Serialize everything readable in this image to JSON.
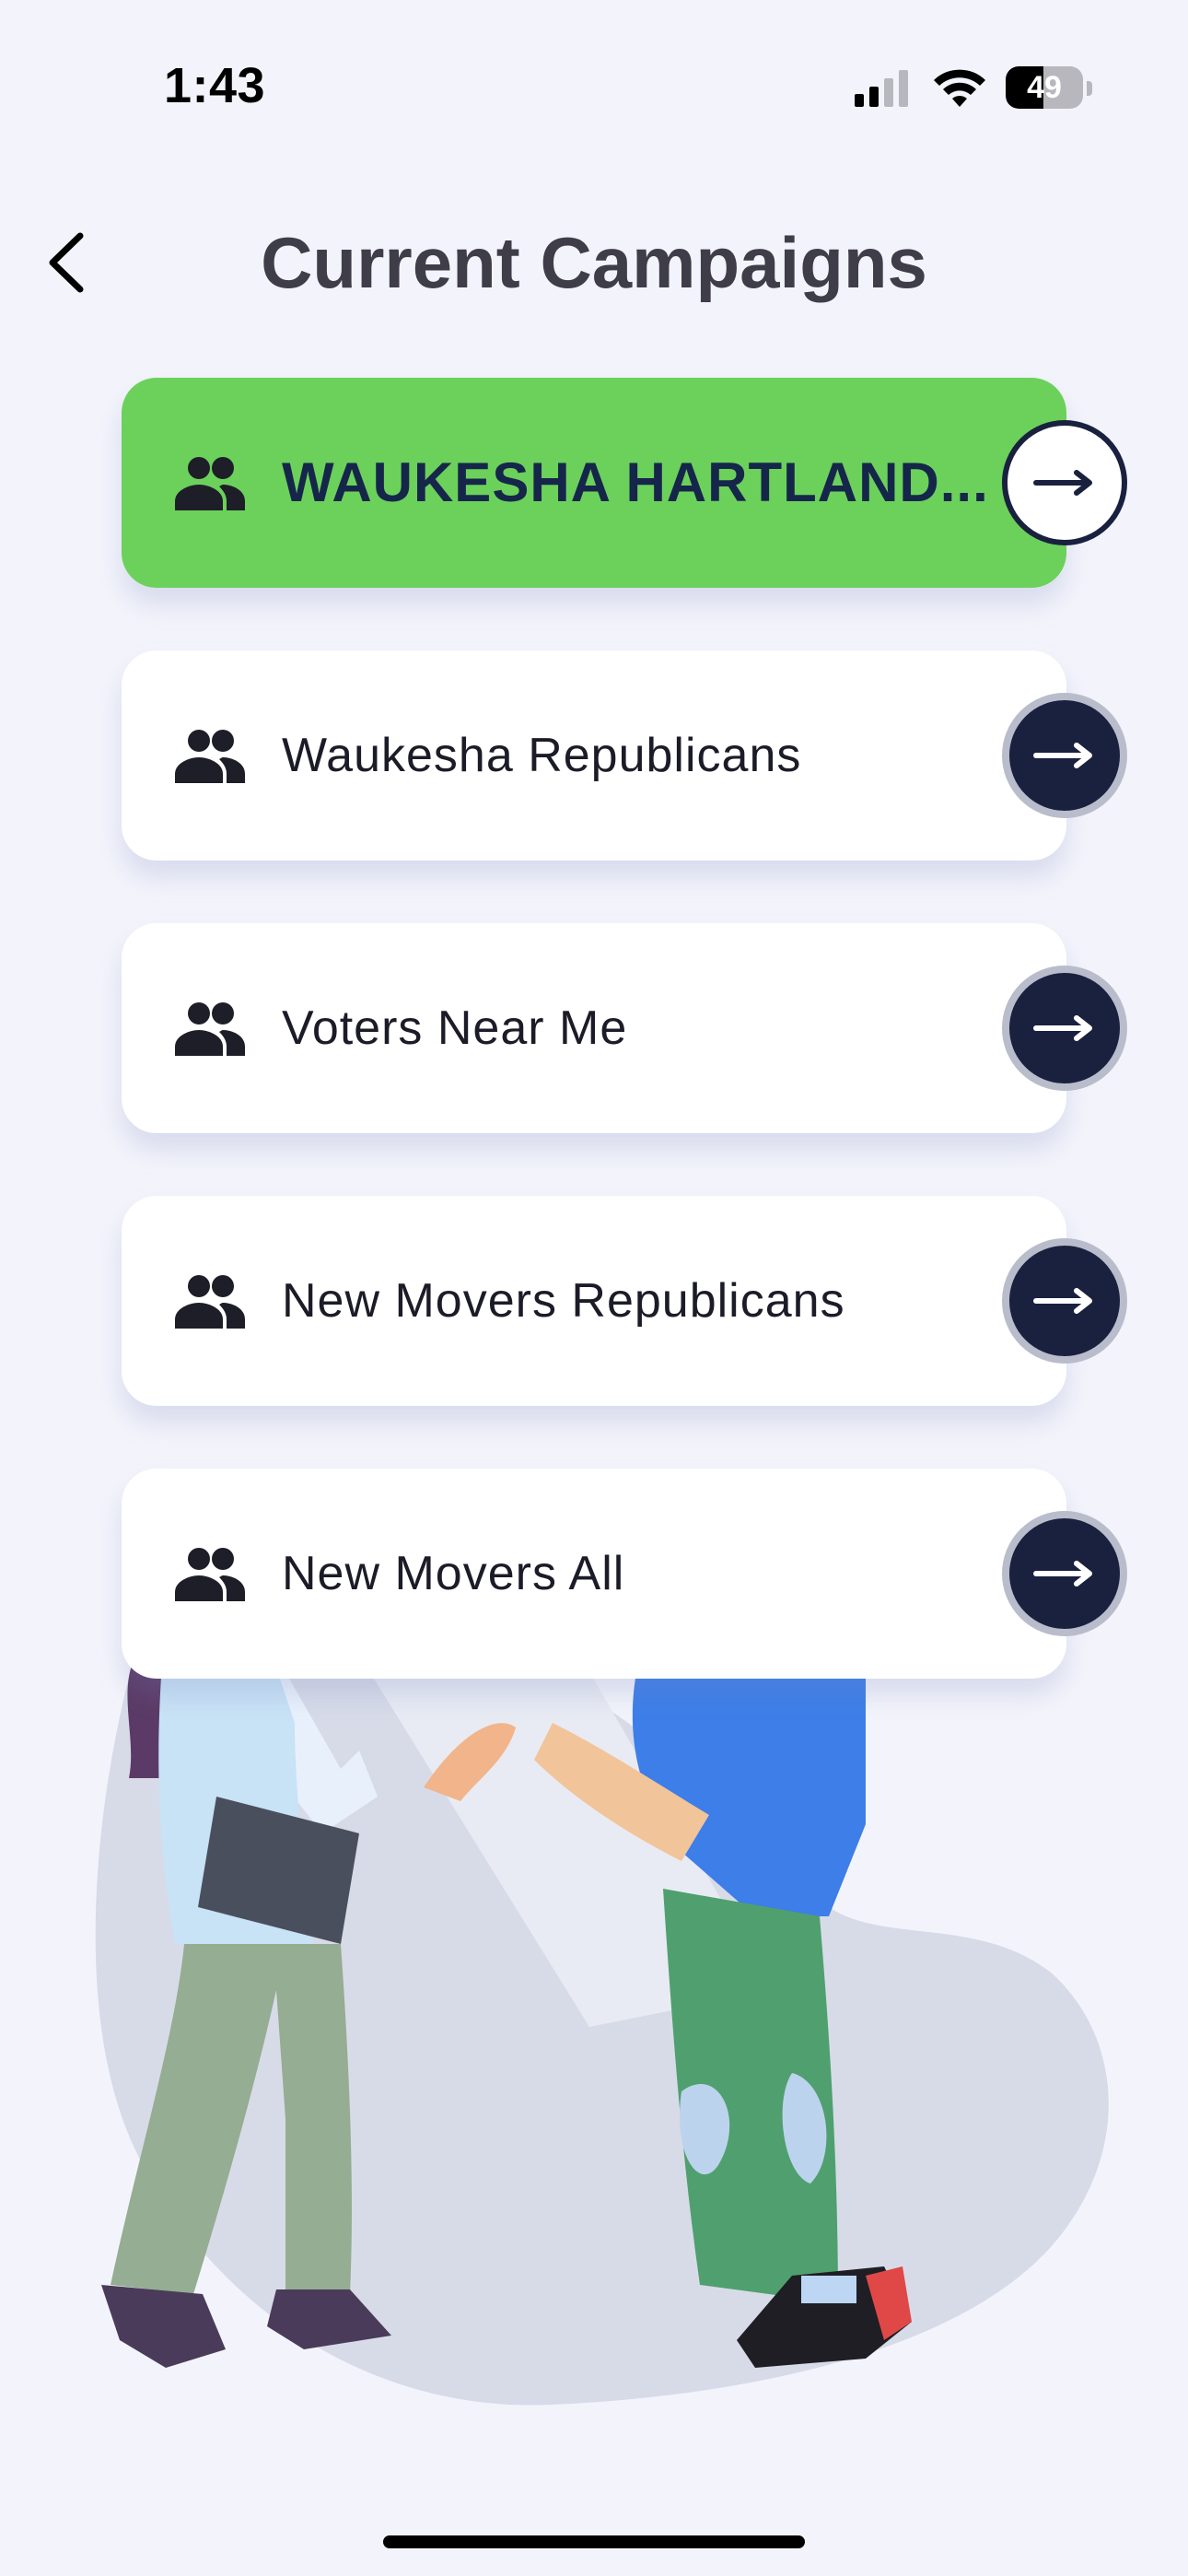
{
  "status_bar": {
    "time": "1:43",
    "battery_percent": "49",
    "battery_level": 0.49,
    "signal_bars_active": 2,
    "signal_bars_total": 4
  },
  "header": {
    "title": "Current Campaigns",
    "back_icon": "chevron-left-icon"
  },
  "campaigns": [
    {
      "label": "WAUKESHA HARTLAND...",
      "selected": true,
      "icon": "group-icon",
      "action_icon": "arrow-right-icon"
    },
    {
      "label": "Waukesha Republicans",
      "selected": false,
      "icon": "group-icon",
      "action_icon": "arrow-right-icon"
    },
    {
      "label": "Voters Near Me",
      "selected": false,
      "icon": "group-icon",
      "action_icon": "arrow-right-icon"
    },
    {
      "label": "New Movers Republicans",
      "selected": false,
      "icon": "group-icon",
      "action_icon": "arrow-right-icon"
    },
    {
      "label": "New Movers All",
      "selected": false,
      "icon": "group-icon",
      "action_icon": "arrow-right-icon"
    }
  ],
  "colors": {
    "background": "#f3f4fb",
    "active_card": "#6bd15b",
    "navy": "#19213f",
    "title": "#3f3d48"
  }
}
